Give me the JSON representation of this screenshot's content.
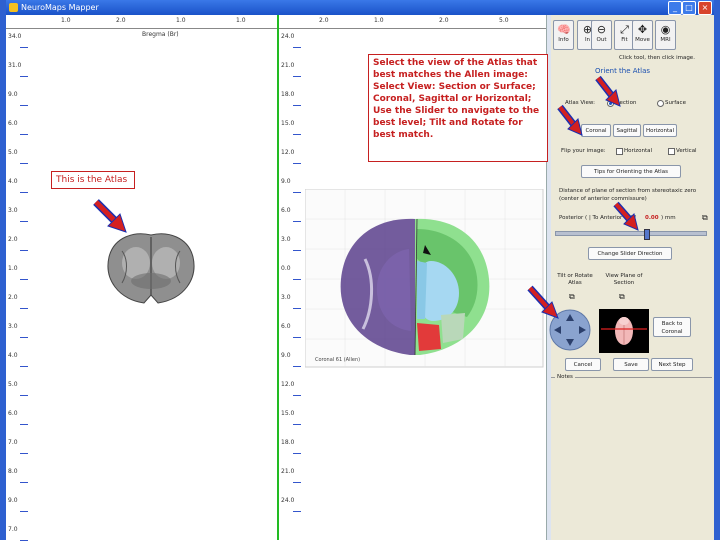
{
  "window": {
    "title": "NeuroMaps Mapper",
    "minimize": "_",
    "maximize": "□",
    "close": "×"
  },
  "atlas_pane": {
    "header_label": "Bregma (Br)",
    "top_ruler": [
      "1.0",
      "2.0",
      "1.0",
      "1.0"
    ],
    "left_ruler": [
      "34.0",
      "31.0",
      "9.0",
      "6.0",
      "5.0",
      "4.0",
      "3.0",
      "2.0",
      "1.0",
      "2.0",
      "3.0",
      "4.0",
      "5.0",
      "6.0",
      "7.0",
      "8.0",
      "9.0",
      "7.0"
    ]
  },
  "image_pane": {
    "top_ruler": [
      "2.0",
      "1.0",
      "2.0",
      "5.0"
    ],
    "left_ruler": [
      "24.0",
      "21.0",
      "18.0",
      "15.0",
      "12.0",
      "9.0",
      "6.0",
      "3.0",
      "0.0",
      "3.0",
      "6.0",
      "9.0",
      "12.0",
      "15.0",
      "18.0",
      "21.0",
      "24.0"
    ],
    "image_caption": "Coronal 61 (Allen)"
  },
  "callouts": {
    "instructions": "Select the view of the Atlas that best matches the Allen image: Select View: Section or Surface; Coronal, Sagittal or Horizontal; Use the Slider to navigate to the best level; Tilt and Rotate for best match.",
    "atlas_label": "This is the Atlas"
  },
  "panel": {
    "tools": [
      {
        "label": "Info",
        "icon": "brain-icon"
      },
      {
        "label": "In",
        "icon": "zoom-in-icon"
      },
      {
        "label": "Out",
        "icon": "zoom-out-icon"
      },
      {
        "label": "Fit",
        "icon": "fit-icon"
      },
      {
        "label": "Move",
        "icon": "move-icon"
      },
      {
        "label": "MRI",
        "icon": "mri-icon"
      }
    ],
    "hint": "Click tool, then click image.",
    "section_title": "Orient the Atlas",
    "atlas_view_label": "Atlas View:",
    "view_section": "Section",
    "view_surface": "Surface",
    "plane_coronal": "Coronal",
    "plane_sagittal": "Sagittal",
    "plane_horizontal": "Horizontal",
    "flip_label": "Flip your image:",
    "flip_horizontal": "Horizontal",
    "flip_vertical": "Vertical",
    "tips_button": "Tips for Orienting the Atlas",
    "distance_text": "Distance of plane of section from stereotaxic zero (center of anterior commissure)",
    "position_label": "Posterior ( | To Anterior + ) (",
    "position_value": "0.00",
    "position_unit": ") mm",
    "slider_value": 0.6,
    "change_slider_button": "Change Slider Direction",
    "tilt_label": "Tilt or Rotate Atlas",
    "view_planes_label": "View Plane of Section",
    "back_to_coronal": "Back to Coronal",
    "cancel_button": "Cancel",
    "save_button": "Save",
    "next_step_button": "Next Step",
    "notes_label": "Notes"
  }
}
